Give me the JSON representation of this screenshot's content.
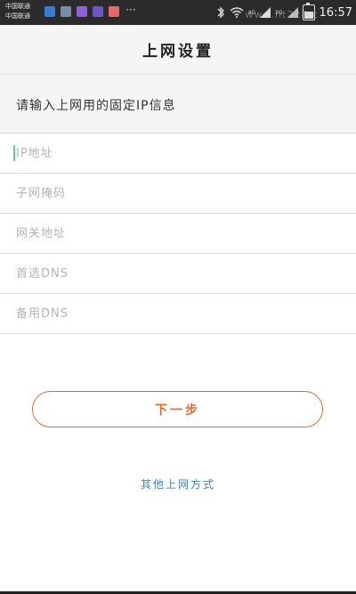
{
  "status_bar": {
    "carrier_line1": "中国联通",
    "carrier_line2": "中国联通",
    "net_type_top": "4G",
    "net_type_bottom": "2G",
    "time": "16:57",
    "watermark": "www.lit228.c",
    "battery_level_percent": 60,
    "colors": {
      "background": "#2b2b2b"
    },
    "notification_icons": [
      {
        "name": "app-notification-icon",
        "color": "#3a7bd5"
      },
      {
        "name": "image-notification-icon",
        "color": "#7a8ca8"
      },
      {
        "name": "chat-notification-icon",
        "color": "#8f5fd6"
      },
      {
        "name": "qq-notification-icon",
        "color": "#6b55c9"
      },
      {
        "name": "store-notification-icon",
        "color": "#e26a6a"
      }
    ]
  },
  "header": {
    "title": "上网设置"
  },
  "instruction": {
    "text": "请输入上网用的固定IP信息"
  },
  "form": {
    "fields": [
      {
        "name": "ip-address-input",
        "placeholder": "IP地址",
        "value": ""
      },
      {
        "name": "subnet-mask-input",
        "placeholder": "子网掩码",
        "value": ""
      },
      {
        "name": "gateway-input",
        "placeholder": "网关地址",
        "value": ""
      },
      {
        "name": "primary-dns-input",
        "placeholder": "首选DNS",
        "value": ""
      },
      {
        "name": "secondary-dns-input",
        "placeholder": "备用DNS",
        "value": ""
      }
    ]
  },
  "next_button": {
    "label": "下一步"
  },
  "other_methods_link": {
    "label": "其他上网方式"
  },
  "colors": {
    "accent": "#e26a2c",
    "link": "#3a84c6",
    "caret": "#59c1d6",
    "header_bg": "#f5f5f5"
  }
}
